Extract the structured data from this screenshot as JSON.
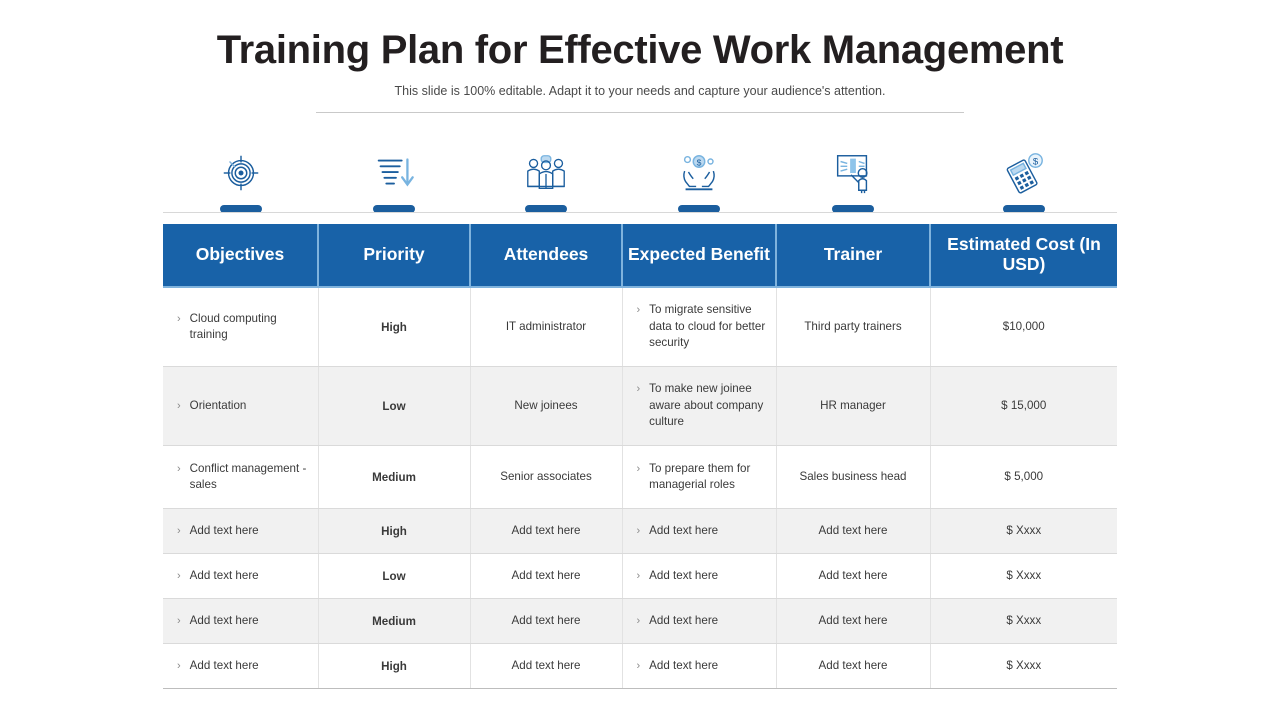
{
  "header": {
    "title": "Training Plan for Effective Work Management",
    "subtitle": "This slide is 100% editable. Adapt it to your needs and capture your audience's attention."
  },
  "icons": [
    {
      "name": "target-icon",
      "label": "Objectives"
    },
    {
      "name": "priority-bars-down-arrow-icon",
      "label": "Priority"
    },
    {
      "name": "people-group-icon",
      "label": "Attendees"
    },
    {
      "name": "hands-holding-money-icon",
      "label": "Expected Benefit"
    },
    {
      "name": "trainer-presentation-board-icon",
      "label": "Trainer"
    },
    {
      "name": "calculator-dollar-icon",
      "label": "Estimated Cost"
    }
  ],
  "table": {
    "headers": [
      "Objectives",
      "Priority",
      "Attendees",
      "Expected Benefit",
      "Trainer",
      "Estimated Cost (In USD)"
    ],
    "rows": [
      {
        "objective": "Cloud computing training",
        "priority": "High",
        "priority_level": "high",
        "attendees": "IT administrator",
        "benefit": "To migrate sensitive data to cloud for better security",
        "trainer": "Third  party trainers",
        "cost": "$10,000"
      },
      {
        "objective": "Orientation",
        "priority": "Low",
        "priority_level": "low",
        "attendees": "New joinees",
        "benefit": "To make new joinee aware  about company culture",
        "trainer": "HR  manager",
        "cost": "$ 15,000"
      },
      {
        "objective": "Conflict management  - sales",
        "priority": "Medium",
        "priority_level": "medium",
        "attendees": "Senior associates",
        "benefit": "To prepare them for managerial roles",
        "trainer": "Sales business head",
        "cost": "$ 5,000"
      },
      {
        "objective": "Add text here",
        "priority": "High",
        "priority_level": "high",
        "attendees": "Add text here",
        "benefit": "Add text here",
        "trainer": "Add text here",
        "cost": "$ Xxxx"
      },
      {
        "objective": "Add text here",
        "priority": "Low",
        "priority_level": "low",
        "attendees": "Add text here",
        "benefit": "Add text here",
        "trainer": "Add text here",
        "cost": "$ Xxxx"
      },
      {
        "objective": "Add text here",
        "priority": "Medium",
        "priority_level": "medium",
        "attendees": "Add text here",
        "benefit": "Add text here",
        "trainer": "Add text here",
        "cost": "$ Xxxx"
      },
      {
        "objective": "Add text here",
        "priority": "High",
        "priority_level": "high",
        "attendees": "Add text here",
        "benefit": "Add text here",
        "trainer": "Add text here",
        "cost": "$ Xxxx"
      }
    ],
    "bullet_glyph": "›"
  },
  "colors": {
    "header_blue": "#1862a8",
    "header_divider": "#7fb3dd",
    "priority_high": "#cc0000",
    "priority_low": "#08893d",
    "priority_medium": "#ffc20e",
    "icon_accent": "#1b5e9e",
    "row_alt": "#f1f1f1",
    "title_text": "#231f20"
  }
}
